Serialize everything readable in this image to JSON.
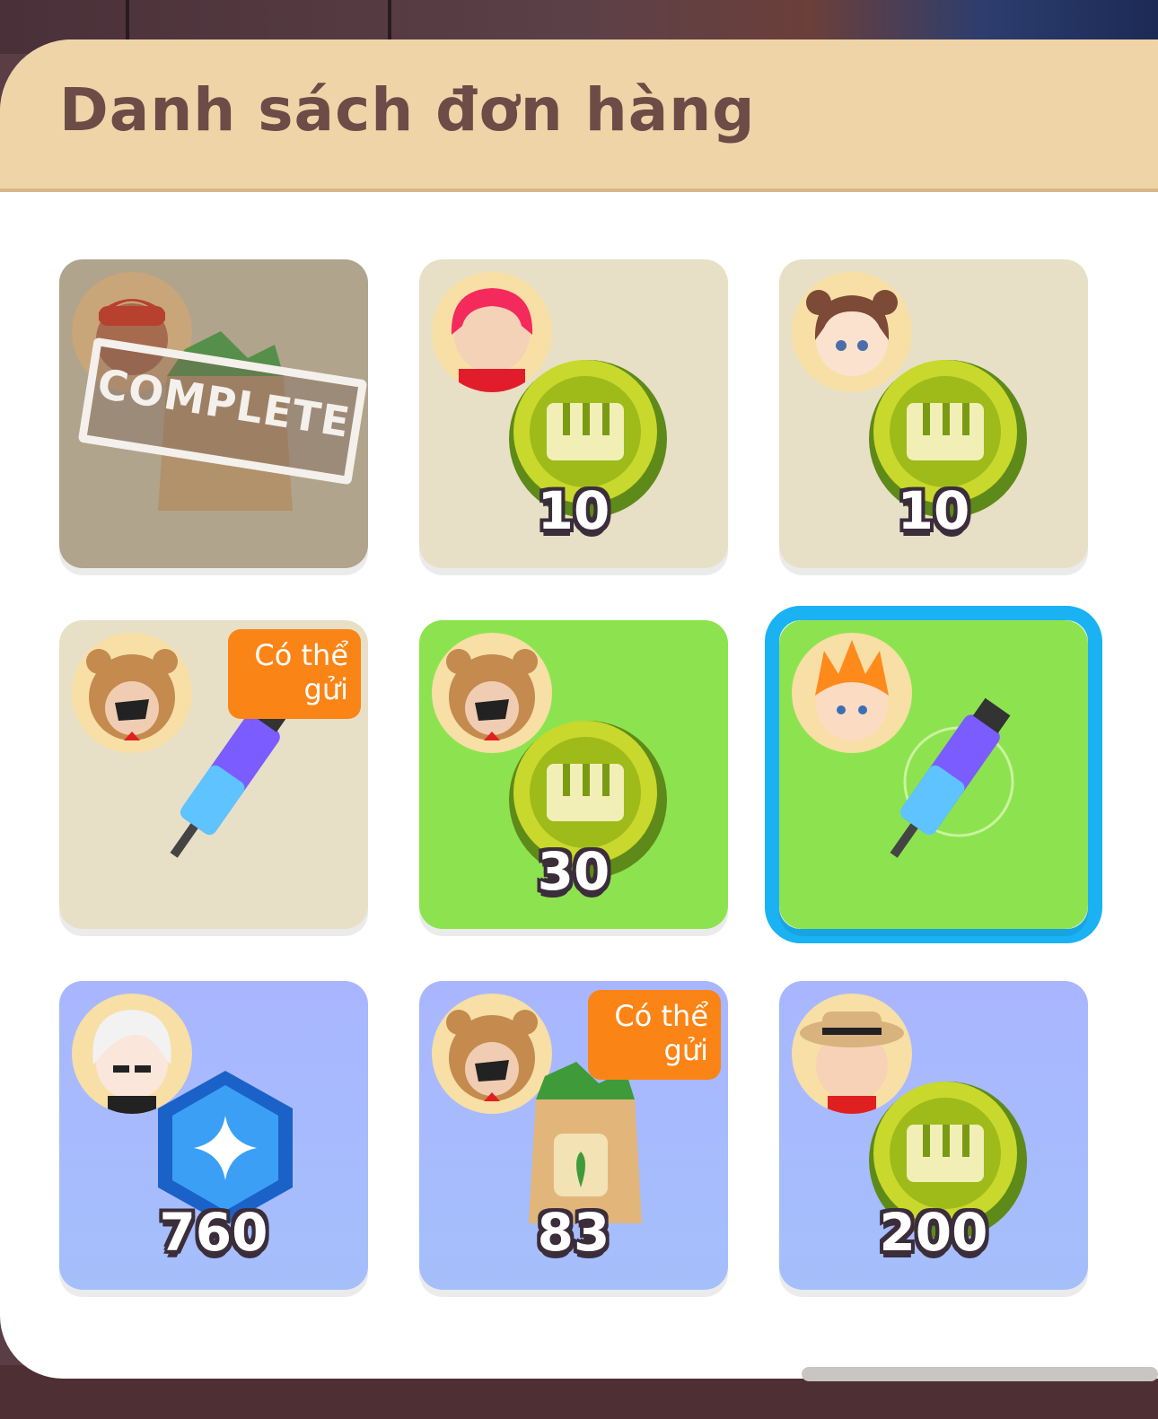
{
  "panel": {
    "title": "Danh sách đơn hàng"
  },
  "orders": [
    {
      "status": "complete",
      "stamp": "COMPLETE",
      "avatar": "red-hair-boy",
      "reward_icon": "seed-bag-icon",
      "amount": ""
    },
    {
      "status": "pending",
      "avatar": "pink-hair-girl",
      "reward_icon": "piano-coin-icon",
      "amount": "10"
    },
    {
      "status": "pending",
      "avatar": "bun-hair-girl",
      "reward_icon": "piano-coin-icon",
      "amount": "10"
    },
    {
      "status": "can-send",
      "badge": "Có thể gửi",
      "avatar": "bear-hood-char",
      "reward_icon": "potion-syringe-icon",
      "amount": ""
    },
    {
      "status": "pending",
      "avatar": "bear-hood-char",
      "reward_icon": "piano-coin-icon",
      "amount": "30"
    },
    {
      "status": "selected",
      "avatar": "orange-hair-boy",
      "reward_icon": "potion-syringe-icon",
      "amount": ""
    },
    {
      "status": "pending",
      "avatar": "white-hair-char",
      "reward_icon": "blue-gem-icon",
      "amount": "760"
    },
    {
      "status": "can-send",
      "badge": "Có thể gửi",
      "avatar": "bear-hood-char",
      "reward_icon": "seed-bag-icon",
      "amount": "83"
    },
    {
      "status": "pending",
      "avatar": "hat-boy",
      "reward_icon": "piano-coin-icon",
      "amount": "200"
    }
  ],
  "colors": {
    "beige": "#e8e0c6",
    "green": "#8de34f",
    "purple": "#a9b6ff",
    "selected": "#1ab2f3",
    "badge": "#fb8416"
  }
}
